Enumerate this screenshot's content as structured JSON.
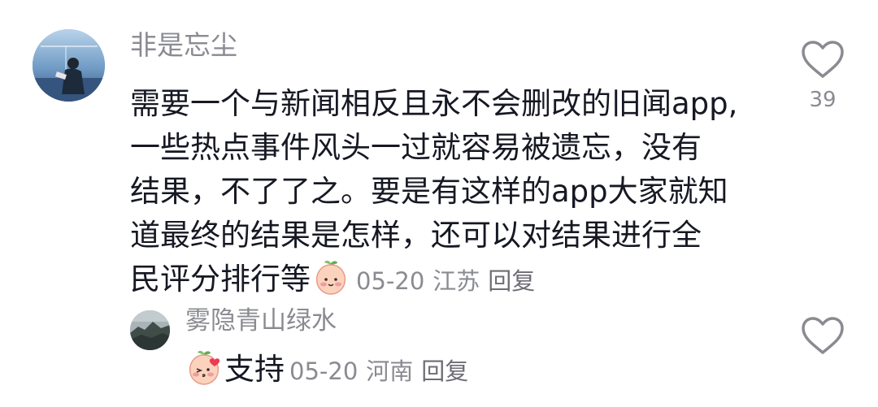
{
  "comment": {
    "username": "非是忘尘",
    "text_lines": [
      "需要一个与新闻相反且永不会删改的旧闻app,",
      "一些热点事件风头一过就容易被遗忘，没有",
      "结果，不了了之。要是有这样的app大家就知",
      "道最终的结果是怎样，还可以对结果进行全",
      "民评分排行等"
    ],
    "emoji": "peach-face-emoji",
    "date": "05-20",
    "location": "江苏",
    "reply_label": "回复",
    "like_count": "39",
    "like_icon": "heart-outline-icon"
  },
  "reply": {
    "username": "雾隐青山绿水",
    "emoji": "peach-kiss-emoji",
    "text": "支持",
    "date": "05-20",
    "location": "河南",
    "reply_label": "回复",
    "like_icon": "heart-outline-icon"
  },
  "colors": {
    "primary_text": "#161823",
    "secondary_text": "#8a8b91",
    "background": "#ffffff"
  }
}
